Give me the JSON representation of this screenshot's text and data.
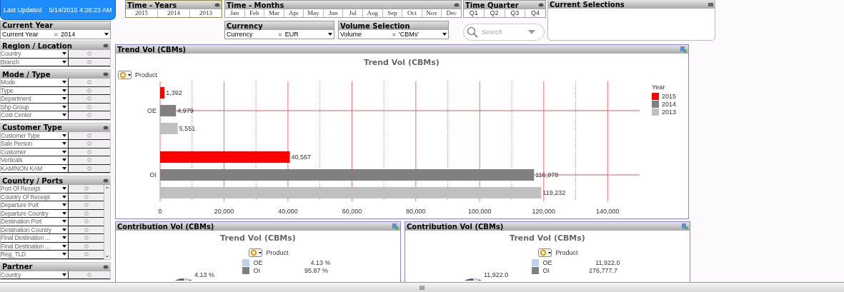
{
  "header": {
    "label": "Last Updated",
    "value": "5/14/2015 4:28:23 AM"
  },
  "current_year": {
    "title": "Current Year",
    "field": "Current Year",
    "operator": "=",
    "value": "2014"
  },
  "time_years": {
    "title": "Time - Years",
    "items": [
      {
        "label": "2015",
        "selected": false
      },
      {
        "label": "2014",
        "selected": false
      },
      {
        "label": "2013",
        "selected": false
      }
    ]
  },
  "time_months": {
    "title": "Time - Months",
    "items": [
      {
        "label": "Jan",
        "selected": false
      },
      {
        "label": "Feb",
        "selected": false
      },
      {
        "label": "Mar",
        "selected": false
      },
      {
        "label": "Apr",
        "selected": false
      },
      {
        "label": "May",
        "selected": false
      },
      {
        "label": "Jun",
        "selected": false
      },
      {
        "label": "Jul",
        "selected": false
      },
      {
        "label": "Aug",
        "selected": false
      },
      {
        "label": "Sep",
        "selected": false
      },
      {
        "label": "Oct",
        "selected": false
      },
      {
        "label": "Nov",
        "selected": false
      },
      {
        "label": "Dec",
        "selected": false
      }
    ]
  },
  "time_quarter": {
    "title": "Time Quarter",
    "items": [
      {
        "label": "Q1",
        "selected": false
      },
      {
        "label": "Q2",
        "selected": false
      },
      {
        "label": "Q3",
        "selected": false
      },
      {
        "label": "Q4",
        "selected": false
      }
    ]
  },
  "currency": {
    "title": "Currency",
    "field": "Currency",
    "operator": "=",
    "value": "EUR"
  },
  "volume_selection": {
    "title": "Volume Selection",
    "field": "Volume",
    "operator": "=",
    "value": "'CBMs'"
  },
  "search": {
    "placeholder": "Search"
  },
  "current_selections": {
    "title": "Current Selections"
  },
  "filter_panels": [
    {
      "title": "Region / Location",
      "scrollable": false,
      "fields": [
        "Country",
        "Branch"
      ]
    },
    {
      "title": "Mode / Type",
      "scrollable": false,
      "fields": [
        "Mode",
        "Type",
        "Department",
        "Shp Group",
        "Cost Center"
      ]
    },
    {
      "title": "Customer Type",
      "scrollable": false,
      "fields": [
        "Customer Type",
        "Sale Person",
        "Customer",
        "Verticals",
        "KAM/NON KAM"
      ]
    },
    {
      "title": "Country / Ports",
      "scrollable": true,
      "fields": [
        "Port Of Receipt",
        "Country Of Receipt",
        "Departure Port",
        "Departure Country",
        "Destination Port",
        "Destination Country",
        "Final Destination ...",
        "Final Destination ...",
        "Reg_TLD"
      ]
    },
    {
      "title": "Partner",
      "scrollable": false,
      "fields": [
        "Country"
      ]
    }
  ],
  "trend_panel": {
    "title": "Trend Vol (CBMs)",
    "cycle_label": "Product",
    "chart_data": {
      "type": "bar",
      "orientation": "horizontal",
      "title": "Trend Vol (CBMs)",
      "categories": [
        "OE",
        "OI"
      ],
      "series": [
        {
          "name": "2015",
          "color": "#ff0000",
          "values": [
            1392,
            40567
          ],
          "value_labels": [
            "1,392",
            "40,567"
          ]
        },
        {
          "name": "2014",
          "color": "#808080",
          "values": [
            4979,
            116978
          ],
          "value_labels": [
            "4,979",
            "116,978"
          ]
        },
        {
          "name": "2013",
          "color": "#c0c0c0",
          "values": [
            5551,
            119232
          ],
          "value_labels": [
            "5,551",
            "119,232"
          ]
        }
      ],
      "xlim": [
        0,
        150000
      ],
      "xticks": [
        {
          "value": 0,
          "label": "0"
        },
        {
          "value": 20000,
          "label": "20,000"
        },
        {
          "value": 40000,
          "label": "40,000"
        },
        {
          "value": 60000,
          "label": "60,000"
        },
        {
          "value": 80000,
          "label": "80,000"
        },
        {
          "value": 100000,
          "label": "100,000"
        },
        {
          "value": 120000,
          "label": "120,000"
        },
        {
          "value": 140000,
          "label": "140,000"
        }
      ],
      "grid": true,
      "ref_lines": [
        {
          "axis": "x",
          "value": 10000
        },
        {
          "axis": "x",
          "value": 30000
        },
        {
          "axis": "x",
          "value": 50000
        },
        {
          "axis": "x",
          "value": 70000
        },
        {
          "axis": "x",
          "value": 90000
        },
        {
          "axis": "x",
          "value": 110000
        },
        {
          "axis": "x",
          "value": 130000
        }
      ],
      "legend": {
        "title": "Year"
      }
    }
  },
  "contribution_panels": [
    {
      "title": "Contribution Vol (CBMs)",
      "chart_title": "Trend Vol (CBMs)",
      "cycle_label": "Product",
      "pie_label": "4.13 %",
      "legend": [
        {
          "label": "OE",
          "value": "4.13 %",
          "color": "#c0d0f0"
        },
        {
          "label": "OI",
          "value": "95.87 %",
          "color": "#808080"
        }
      ]
    },
    {
      "title": "Contribution Vol (CBMs)",
      "chart_title": "Trend Vol (CBMs)",
      "cycle_label": "Product",
      "pie_label": "11,922.0",
      "legend": [
        {
          "label": "OE",
          "value": "11,922.0",
          "color": "#c0d0f0"
        },
        {
          "label": "OI",
          "value": "276,777.7",
          "color": "#808080"
        }
      ]
    }
  ]
}
